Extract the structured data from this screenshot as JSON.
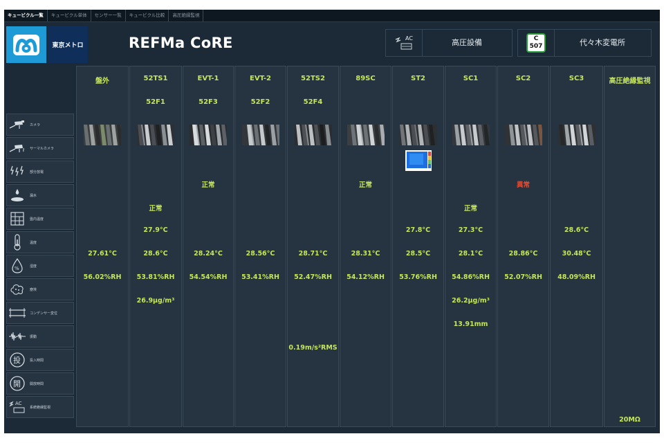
{
  "nav": {
    "tabs": [
      "キュービクル一覧",
      "キュービクル単体",
      "センサー一覧",
      "キュービクル比較",
      "高圧絶縁監視"
    ]
  },
  "header": {
    "brand": "東京メトロ",
    "title": "REFMa CoRE",
    "equipment_icon_text": "AC",
    "equipment_label": "高圧設備",
    "station_code_letter": "C",
    "station_code_number": "507",
    "station_label": "代々木変電所"
  },
  "colors": {
    "value_text": "#c5e65a",
    "alarm_text": "#e84a2e",
    "panel_bg": "#263441",
    "app_bg": "#1b2a36",
    "brand_blue": "#1e9bd7"
  },
  "sensors": [
    {
      "icon": "camera-icon",
      "label": "カメラ"
    },
    {
      "icon": "thermal-camera-icon",
      "label": "サーマルカメラ"
    },
    {
      "icon": "partial-discharge-icon",
      "label": "部分放電"
    },
    {
      "icon": "water-leak-icon",
      "label": "漏水"
    },
    {
      "icon": "panel-temperature-icon",
      "label": "盤内温度"
    },
    {
      "icon": "thermometer-icon",
      "label": "温度"
    },
    {
      "icon": "humidity-icon",
      "label": "湿度"
    },
    {
      "icon": "dust-icon",
      "label": "塵埃"
    },
    {
      "icon": "capacitor-icon",
      "label": "コンデンサー変位"
    },
    {
      "icon": "vibration-icon",
      "label": "振動"
    },
    {
      "icon": "close-time-icon",
      "label": "投入時間"
    },
    {
      "icon": "open-time-icon",
      "label": "開放時間"
    },
    {
      "icon": "insulation-icon",
      "label": "系統絶縁監視"
    }
  ],
  "columns": [
    {
      "name": "盤外",
      "sub": "",
      "camera": true,
      "thermal": false,
      "values": {
        "temp": "27.61°C",
        "humidity": "56.02%RH"
      }
    },
    {
      "name": "52TS1",
      "sub": "52F1",
      "camera": true,
      "thermal": false,
      "values": {
        "leak": "正常",
        "panel_temp": "27.9°C",
        "temp": "28.6°C",
        "humidity": "53.81%RH",
        "dust": "26.9μg/m³"
      }
    },
    {
      "name": "EVT-1",
      "sub": "52F3",
      "camera": true,
      "thermal": false,
      "values": {
        "pd": "正常",
        "temp": "28.24°C",
        "humidity": "54.54%RH"
      }
    },
    {
      "name": "EVT-2",
      "sub": "52F2",
      "camera": true,
      "thermal": false,
      "values": {
        "temp": "28.56°C",
        "humidity": "53.41%RH"
      }
    },
    {
      "name": "52TS2",
      "sub": "52F4",
      "camera": true,
      "thermal": false,
      "values": {
        "temp": "28.71°C",
        "humidity": "52.47%RH",
        "vibration": "0.19m/s²RMS"
      }
    },
    {
      "name": "89SC",
      "sub": "",
      "camera": true,
      "thermal": false,
      "values": {
        "pd": "正常",
        "temp": "28.31°C",
        "humidity": "54.12%RH"
      }
    },
    {
      "name": "ST2",
      "sub": "",
      "camera": true,
      "thermal": true,
      "values": {
        "panel_temp": "27.8°C",
        "temp": "28.5°C",
        "humidity": "53.76%RH"
      }
    },
    {
      "name": "SC1",
      "sub": "",
      "camera": true,
      "thermal": false,
      "values": {
        "leak": "正常",
        "panel_temp": "27.3°C",
        "temp": "28.1°C",
        "humidity": "54.86%RH",
        "dust": "26.2μg/m³",
        "capacitor": "13.91mm"
      }
    },
    {
      "name": "SC2",
      "sub": "",
      "camera": true,
      "thermal": false,
      "values": {
        "pd": "異常",
        "temp": "28.86°C",
        "humidity": "52.07%RH"
      }
    },
    {
      "name": "SC3",
      "sub": "",
      "camera": true,
      "thermal": false,
      "values": {
        "panel_temp": "28.6°C",
        "temp": "30.48°C",
        "humidity": "48.09%RH"
      }
    },
    {
      "name": "高圧絶縁監視",
      "sub": "",
      "camera": false,
      "thermal": false,
      "values": {
        "insulation": "20MΩ"
      }
    }
  ]
}
